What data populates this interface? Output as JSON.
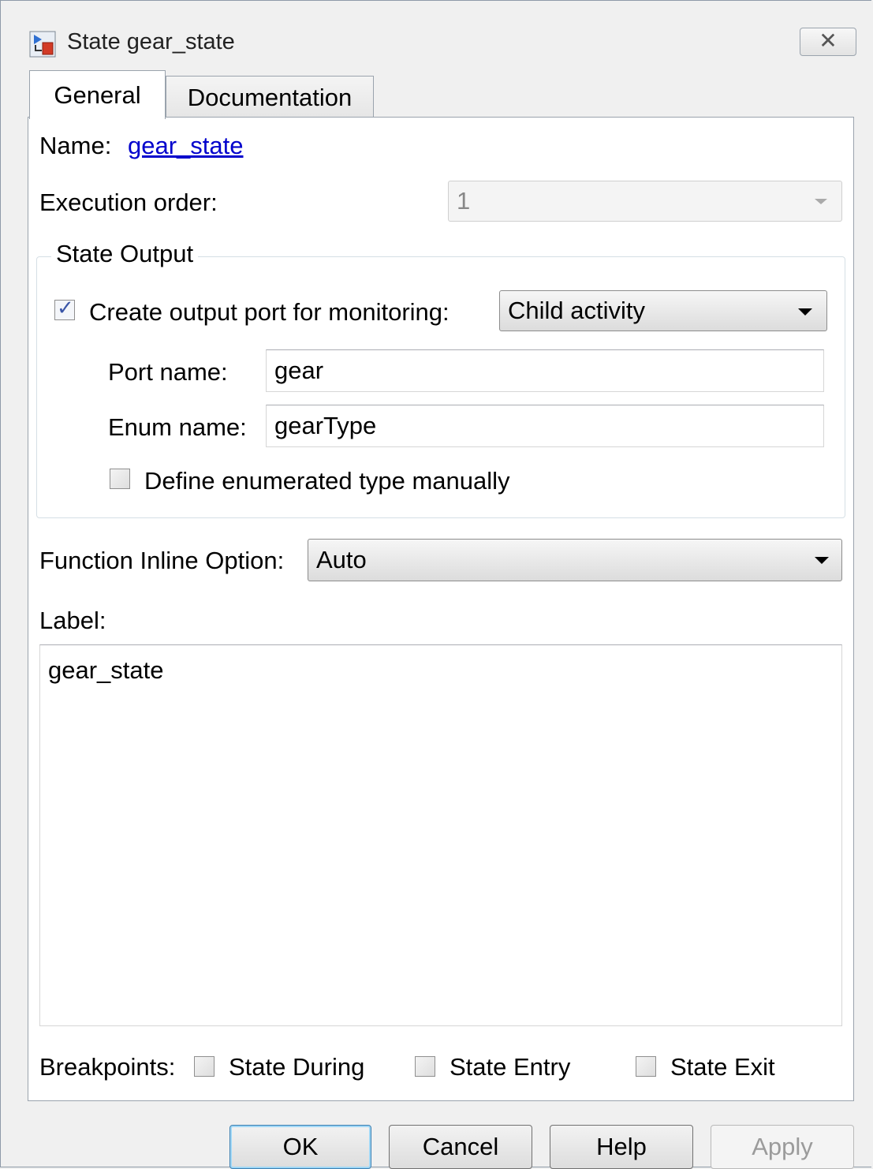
{
  "window": {
    "title": "State gear_state",
    "close_glyph": "✕"
  },
  "tabs": [
    {
      "label": "General",
      "selected": true
    },
    {
      "label": "Documentation",
      "selected": false
    }
  ],
  "general": {
    "name_label": "Name:",
    "name_value": "gear_state",
    "execution_order_label": "Execution order:",
    "execution_order_value": "1",
    "state_output": {
      "legend": "State Output",
      "create_port_checked": true,
      "create_port_label": "Create output port for monitoring:",
      "monitoring_value": "Child activity",
      "port_name_label": "Port name:",
      "port_name_value": "gear",
      "enum_name_label": "Enum name:",
      "enum_name_value": "gearType",
      "define_enum_checked": false,
      "define_enum_label": "Define enumerated type manually"
    },
    "function_inline_label": "Function Inline Option:",
    "function_inline_value": "Auto",
    "label_label": "Label:",
    "label_value": "gear_state",
    "breakpoints": {
      "label": "Breakpoints:",
      "items": [
        {
          "label": "State During",
          "checked": false
        },
        {
          "label": "State Entry",
          "checked": false
        },
        {
          "label": "State Exit",
          "checked": false
        }
      ]
    }
  },
  "buttons": {
    "ok": "OK",
    "cancel": "Cancel",
    "help": "Help",
    "apply": "Apply"
  },
  "icons": {
    "app": "stateflow-state-icon",
    "check": "✓"
  },
  "colors": {
    "link": "#0000cc",
    "checkmark": "#3b56a8",
    "panel_bg": "#ffffff",
    "window_bg": "#f0f0f0"
  }
}
